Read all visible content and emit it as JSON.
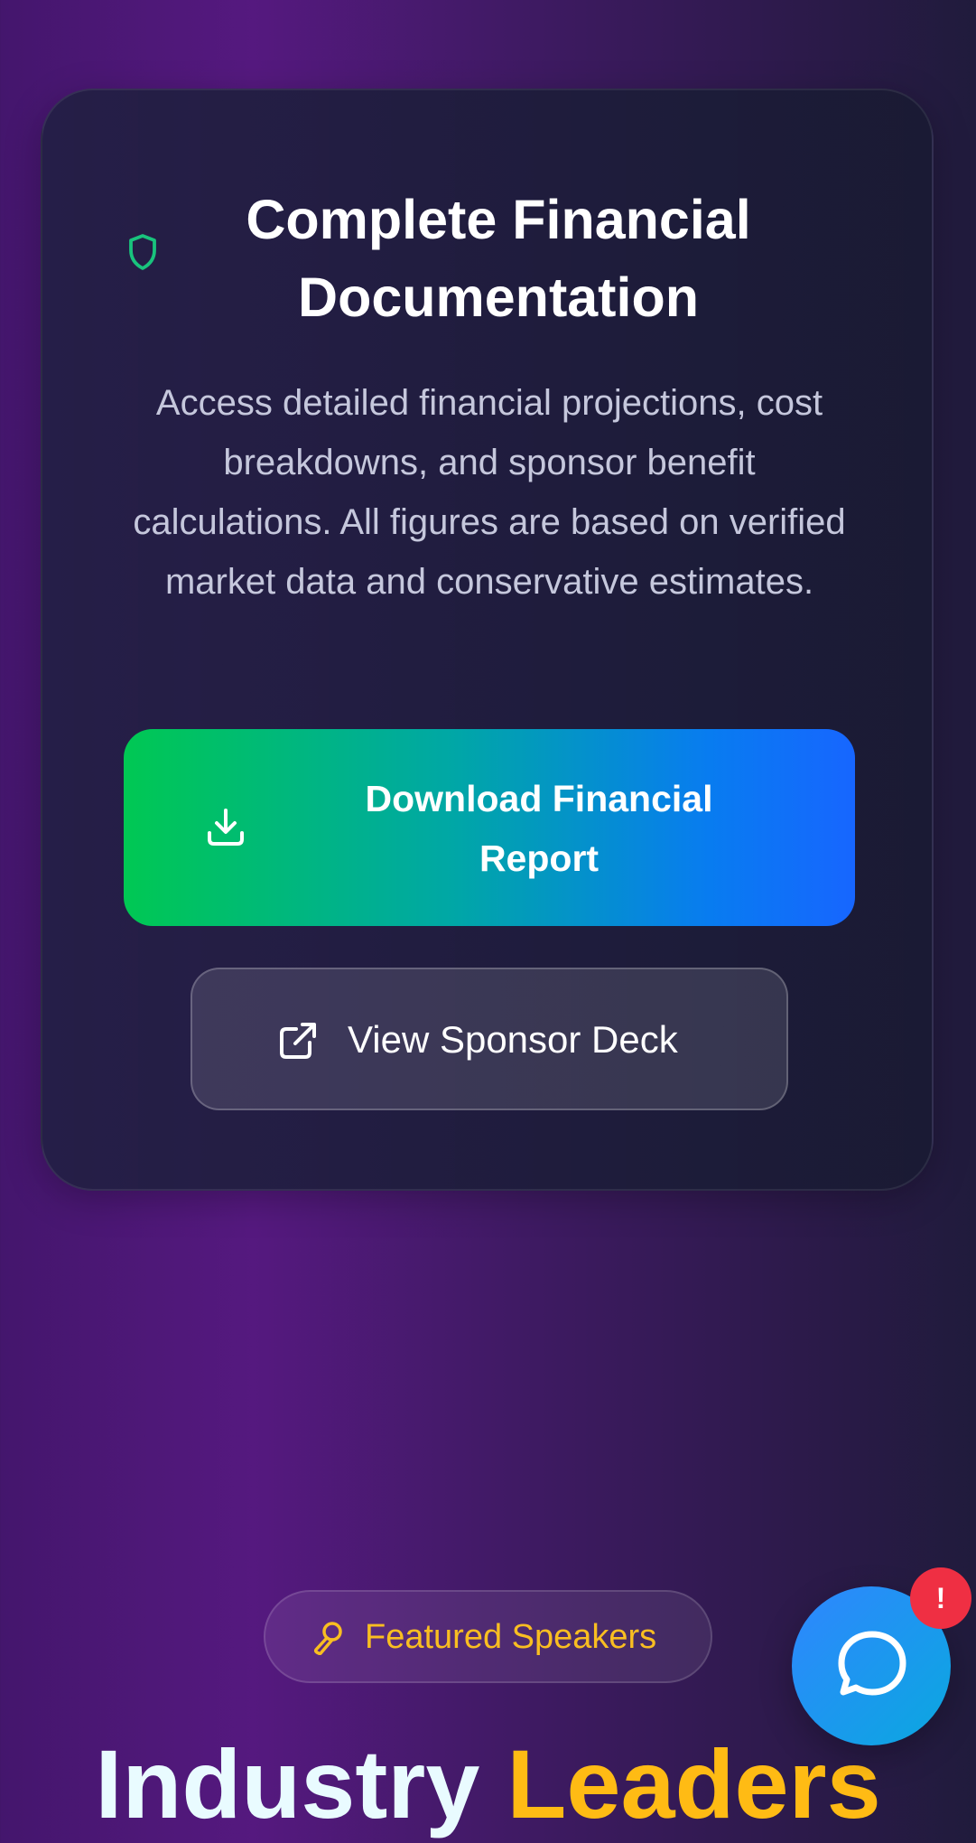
{
  "financial_docs": {
    "title": "Complete Financial Documentation",
    "description": "Access detailed financial projections, cost breakdowns, and sponsor benefit calculations. All figures are based on verified market data and conservative estimates.",
    "primary_button": "Download Financial Report",
    "secondary_button": "View Sponsor Deck",
    "icons": {
      "title": "shield-icon",
      "primary": "download-icon",
      "secondary": "external-link-icon"
    },
    "colors": {
      "shield": "#19c37d",
      "primary_gradient_start": "#00c853",
      "primary_gradient_end": "#1766ff"
    }
  },
  "speakers": {
    "badge_label": "Featured Speakers",
    "badge_icon": "microphone-icon",
    "heading_part_1": "Industry",
    "heading_part_2": "Leaders",
    "colors": {
      "badge_text": "#f9be21",
      "heading_part_1": "#e9fbff",
      "heading_part_2": "#ffbb14"
    }
  },
  "chat": {
    "icon": "chat-bubble-icon",
    "notification": "!",
    "colors": {
      "fab": "#2f86ff",
      "badge": "#ef2f43"
    }
  }
}
